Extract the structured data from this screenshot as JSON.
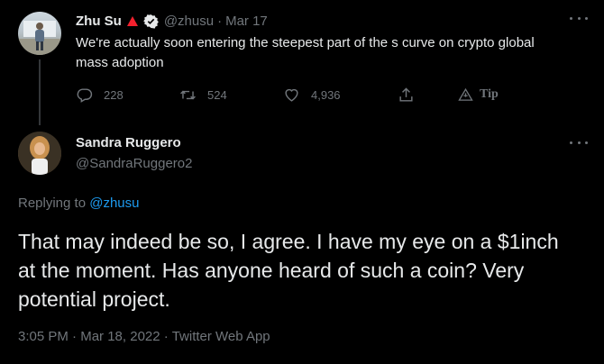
{
  "parent_tweet": {
    "name": "Zhu Su",
    "handle": "@zhusu",
    "separator": "·",
    "date": "Mar 17",
    "text": "We're actually soon entering the steepest part of the s curve on crypto global mass adoption",
    "badge_color": "#f4212e",
    "verified_icon": "verified-badge-icon",
    "actions": {
      "replies": "228",
      "retweets": "524",
      "likes": "4,936",
      "tip_label": "Tip"
    }
  },
  "reply_tweet": {
    "name": "Sandra Ruggero",
    "handle": "@SandraRuggero2",
    "replying_prefix": "Replying to",
    "replying_to": "@zhusu",
    "text": "That may indeed be so, I agree. I have my eye on a $1inch at the moment. Has anyone heard of such a coin? Very potential project.",
    "time": "3:05 PM",
    "sep": "·",
    "date": "Mar 18, 2022",
    "source": "Twitter Web App"
  },
  "colors": {
    "background": "#000000",
    "text": "#e7e9ea",
    "secondary": "#71767b",
    "link": "#1d9bf0"
  }
}
